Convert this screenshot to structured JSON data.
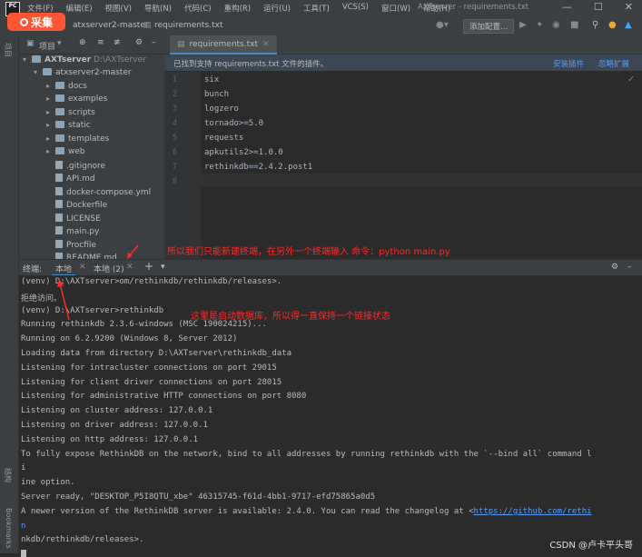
{
  "titlebar": {
    "menu": [
      "文件(F)",
      "编辑(E)",
      "视图(V)",
      "导航(N)",
      "代码(C)",
      "重构(R)",
      "运行(U)",
      "工具(T)",
      "VCS(S)",
      "窗口(W)",
      "帮助(H)"
    ],
    "window_title": "AXTserver - requirements.txt"
  },
  "badge": {
    "label": "采集",
    "color": "#fc5531"
  },
  "navbar": {
    "crumb_project": "atxserver2-master",
    "crumb_file": "requirements.txt",
    "run_config": "添加配置..."
  },
  "project": {
    "title": "项目",
    "root_name": "AXTserver",
    "root_path": "D:\\AXTserver",
    "items": [
      {
        "type": "folder",
        "name": "atxserver2-master",
        "open": true
      },
      {
        "type": "folder",
        "name": "docs"
      },
      {
        "type": "folder",
        "name": "examples"
      },
      {
        "type": "folder",
        "name": "scripts"
      },
      {
        "type": "folder",
        "name": "static"
      },
      {
        "type": "folder",
        "name": "templates"
      },
      {
        "type": "folder",
        "name": "web"
      },
      {
        "type": "file",
        "name": ".gitignore"
      },
      {
        "type": "file",
        "name": "API.md"
      },
      {
        "type": "file",
        "name": "docker-compose.yml"
      },
      {
        "type": "file",
        "name": "Dockerfile"
      },
      {
        "type": "file",
        "name": "LICENSE"
      },
      {
        "type": "file",
        "name": "main.py"
      },
      {
        "type": "file",
        "name": "Procfile"
      },
      {
        "type": "file",
        "name": "README.md"
      }
    ]
  },
  "left_strip": {
    "structure": "结构",
    "bookmarks": "Bookmarks"
  },
  "editor": {
    "tab_label": "requirements.txt",
    "banner_text": "已找到支持 requirements.txt 文件的插件。",
    "banner_install": "安装插件",
    "banner_ignore": "忽略扩展",
    "lines": [
      "six",
      "bunch",
      "logzero",
      "tornado>=5.0",
      "requests",
      "apkutils2>=1.0.0",
      "rethinkdb==2.4.2.post1",
      ""
    ],
    "line_numbers": [
      "1",
      "2",
      "3",
      "4",
      "5",
      "6",
      "7",
      "8"
    ]
  },
  "terminal": {
    "label": "终端:",
    "tab_local": "本地",
    "tab_local2": "本地 (2)",
    "lines": [
      "(venv) D:\\AXTserver>om/rethinkdb/rethinkdb/releases>.",
      "拒绝访问。",
      "(venv) D:\\AXTserver>rethinkdb",
      "Running rethinkdb 2.3.6-windows (MSC 190024215)...",
      "Running on 6.2.9200 (Windows 8, Server 2012)",
      "Loading data from directory D:\\AXTserver\\rethinkdb_data",
      "Listening for intracluster connections on port 29015",
      "Listening for client driver connections on port 28015",
      "Listening for administrative HTTP connections on port 8080",
      "Listening on cluster address: 127.0.0.1",
      "Listening on driver address: 127.0.0.1",
      "Listening on http address: 127.0.0.1",
      "To fully expose RethinkDB on the network, bind to all addresses by running rethinkdb with the `--bind all` command l",
      "i",
      "ine option.",
      "Server ready, \"DESKTOP_P5I8QTU_xbe\" 46315745-f61d-4bb1-9717-efd75865a0d5",
      "A newer version of the RethinkDB server is available: 2.4.0. You can read the changelog at <",
      "n",
      "nkdb/rethinkdb/releases>."
    ],
    "link_text": "https://github.com/rethi"
  },
  "annotations": {
    "top": "所以我们只能新建终端，在另外一个终端输入 命令：python main.py",
    "middle": "这里是启动数据库，所以得一直保持一个链接状态",
    "color": "#ff2a2a"
  },
  "watermark": "CSDN @卢卡平头哥"
}
